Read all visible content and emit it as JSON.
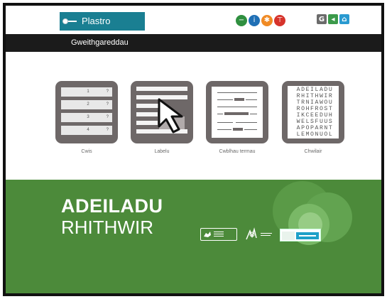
{
  "header": {
    "breadcrumb": "Plastro",
    "nav_icons": [
      {
        "name": "minus-circle-icon",
        "color": "#2f8f3f",
        "glyph": "−"
      },
      {
        "name": "info-circle-icon",
        "color": "#1f6fb5",
        "glyph": "i"
      },
      {
        "name": "settings-circle-icon",
        "color": "#f08a24",
        "glyph": "✱"
      },
      {
        "name": "tools-circle-icon",
        "color": "#d6332b",
        "glyph": "⊤"
      }
    ],
    "right_icons": [
      {
        "name": "glossary-icon",
        "color": "#6b6b6b",
        "glyph": "G"
      },
      {
        "name": "back-icon",
        "color": "#3b9a4a",
        "glyph": "◂"
      },
      {
        "name": "home-icon",
        "color": "#2a9ad0",
        "glyph": "⌂"
      }
    ]
  },
  "section": {
    "title": "Gweithgareddau"
  },
  "activities": [
    {
      "label": "Cwis",
      "rows": [
        "1",
        "2",
        "3",
        "4"
      ],
      "row_mark": "?"
    },
    {
      "label": "Labelu"
    },
    {
      "label": "Cwblhau termau"
    },
    {
      "label": "Chwilair",
      "grid": [
        "ADEILADU",
        "RHITHWIR",
        "TRNIAWOU",
        "ROHFROST",
        "IKCEEDUH",
        "WELSFUUS",
        "APOPARNT",
        "LEMONUOL"
      ]
    }
  ],
  "footer": {
    "brand_line1": "ADEILADU",
    "brand_line2": "RHITHWIR",
    "background": "#4c8a3a"
  },
  "colors": {
    "breadcrumb_bg": "#1a7f92",
    "strip_bg": "#1b1b1b",
    "tile_bg": "#6e6868"
  }
}
